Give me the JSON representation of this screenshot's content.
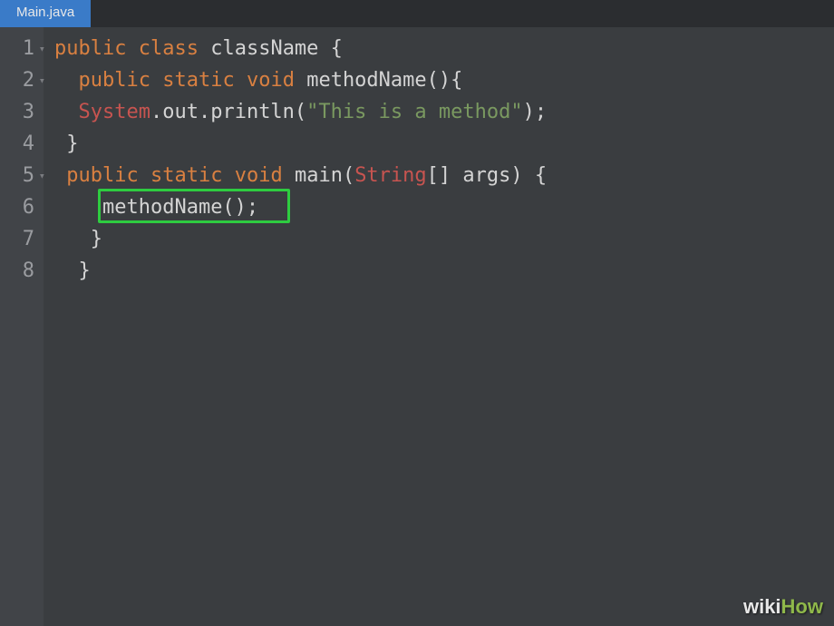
{
  "tab": {
    "label": "Main.java"
  },
  "gutter": {
    "lines": [
      "1",
      "2",
      "3",
      "4",
      "5",
      "6",
      "7",
      "8"
    ],
    "foldable": [
      0,
      1,
      4
    ]
  },
  "code": {
    "line1": {
      "kw1": "public",
      "kw2": "class",
      "ident": "className",
      "brace": " {"
    },
    "line2": {
      "indent": "  ",
      "kw1": "public",
      "kw2": "static",
      "kw3": "void",
      "ident": "methodName",
      "parens": "(){"
    },
    "line3": {
      "indent": "  ",
      "sys": "System",
      "rest": ".out.println(",
      "str": "\"This is a method\"",
      "end": ");"
    },
    "line4": {
      "indent": " ",
      "brace": "}"
    },
    "line5": {
      "indent": " ",
      "kw1": "public",
      "kw2": "static",
      "kw3": "void",
      "ident": "main",
      "paren1": "(",
      "type": "String",
      "rest": "[] args) {"
    },
    "line6": {
      "indent": "    ",
      "call": "methodName();"
    },
    "line7": {
      "indent": "   ",
      "brace": "}"
    },
    "line8": {
      "indent": "  ",
      "brace": "}"
    }
  },
  "watermark": {
    "wiki": "wiki",
    "how": "How"
  }
}
